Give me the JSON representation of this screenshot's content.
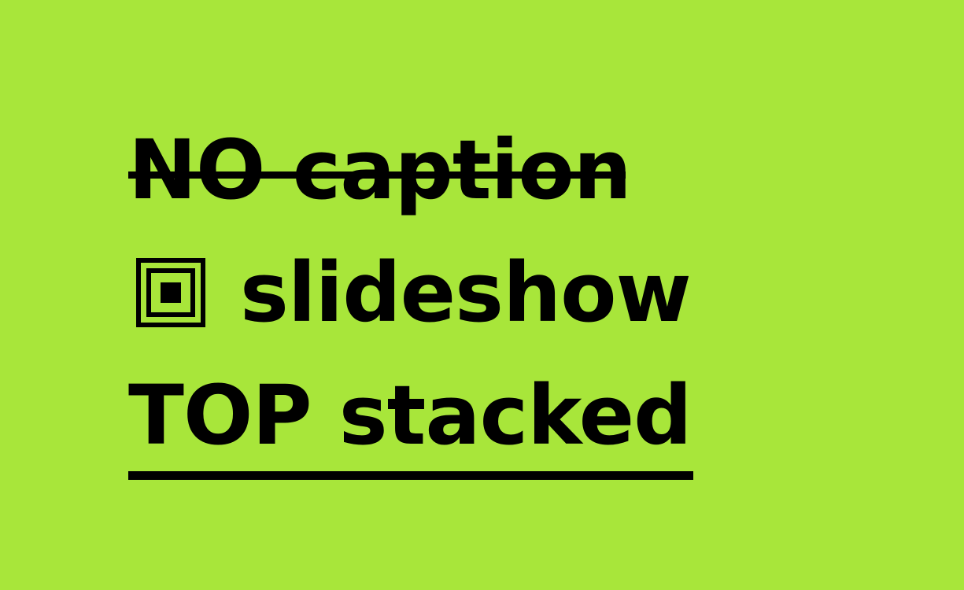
{
  "colors": {
    "background": "#a8e63a",
    "text": "#000000"
  },
  "lines": [
    {
      "text": "NO caption",
      "decoration": "strikethrough"
    },
    {
      "icon": "concentric-square-icon",
      "text": "slideshow"
    },
    {
      "text": "TOP stacked",
      "decoration": "underline"
    }
  ]
}
